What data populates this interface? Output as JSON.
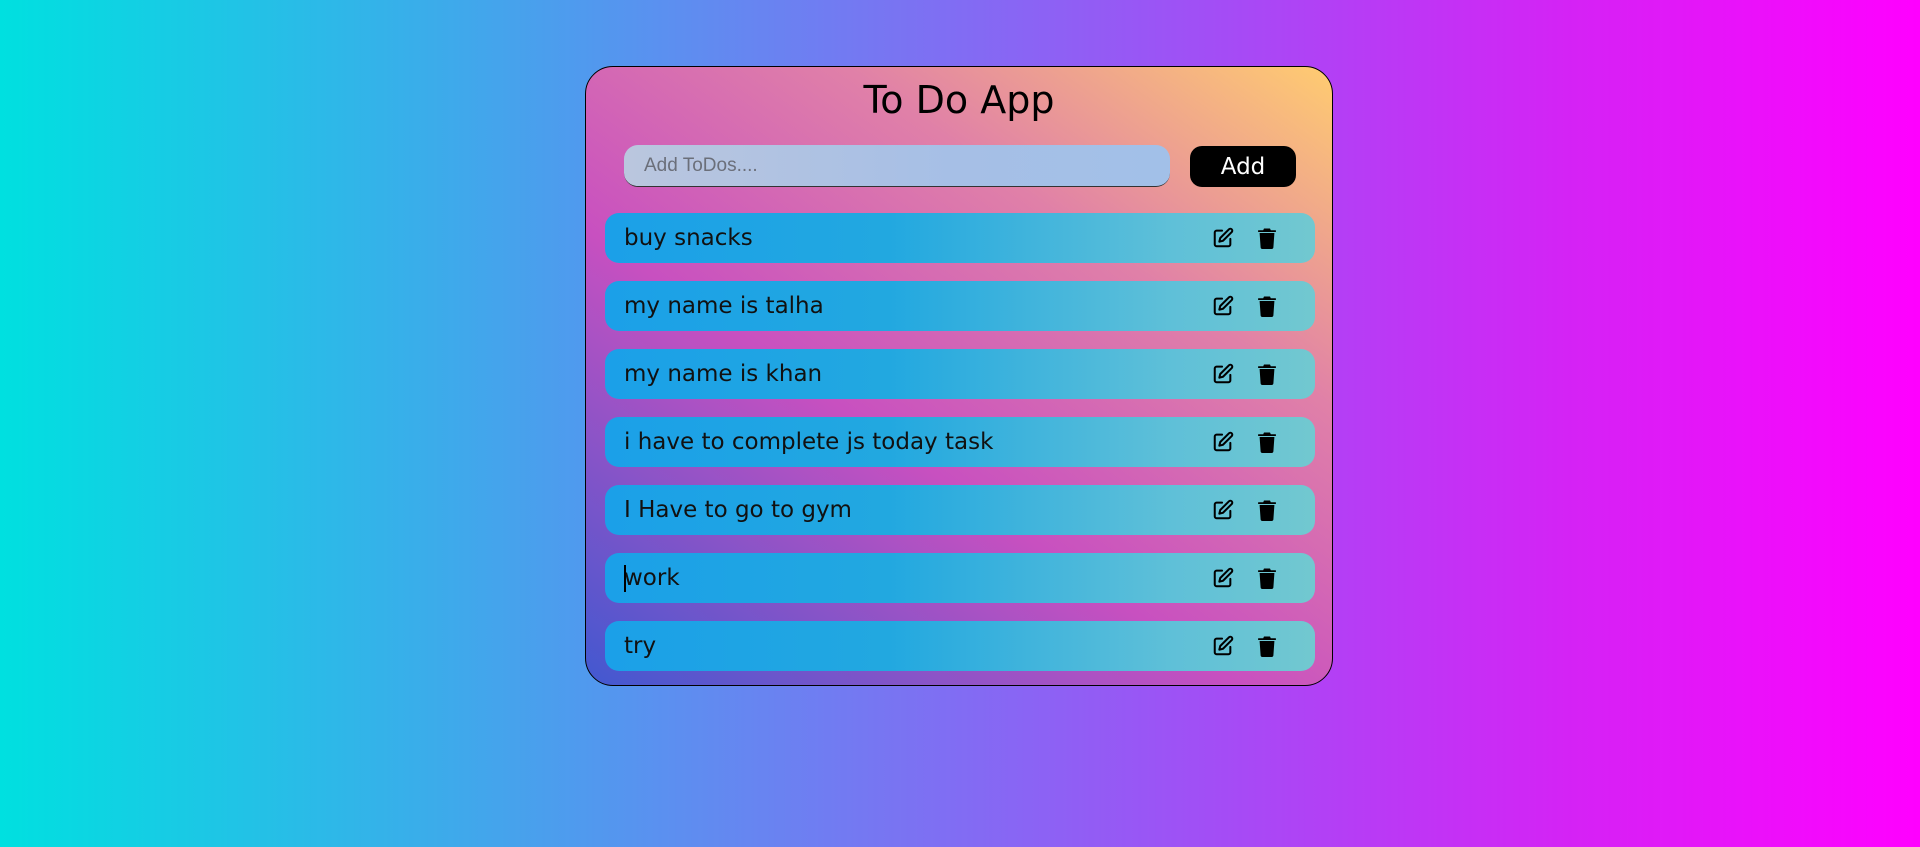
{
  "app": {
    "title": "To Do App"
  },
  "form": {
    "placeholder": "Add ToDos....",
    "value": "",
    "add_label": "Add"
  },
  "todos": [
    {
      "text": "buy snacks"
    },
    {
      "text": "my name is talha"
    },
    {
      "text": "my name is khan"
    },
    {
      "text": "i have to complete js today task"
    },
    {
      "text": "I Have to go to gym"
    },
    {
      "text": "work",
      "editing": true
    },
    {
      "text": "try"
    }
  ],
  "icons": {
    "edit": "edit-icon",
    "delete": "trash-icon"
  },
  "colors": {
    "button_bg": "#000000",
    "button_text": "#ffffff",
    "item_start": "#1ba0e8",
    "item_end": "#72c8d0"
  }
}
